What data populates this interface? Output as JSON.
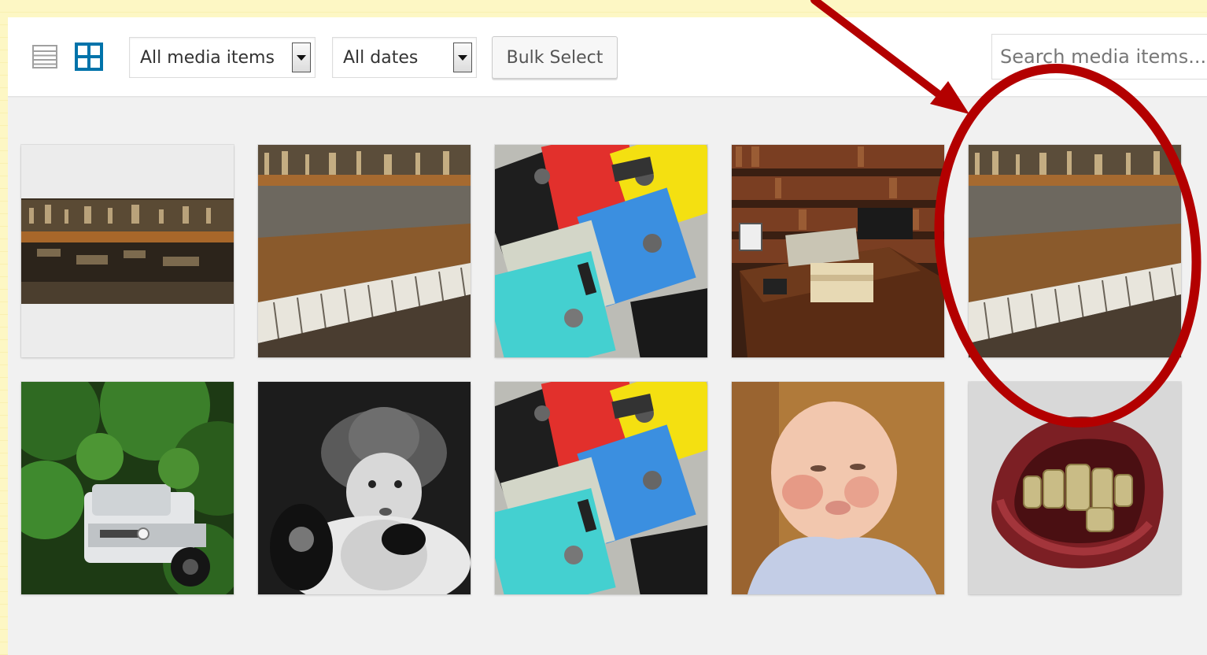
{
  "toolbar": {
    "view_list_icon": "list-view-icon",
    "view_grid_icon": "grid-view-icon",
    "filter_type": "All media items",
    "filter_date": "All dates",
    "bulk_select_label": "Bulk Select",
    "search_placeholder": "Search media items..."
  },
  "colors": {
    "accent": "#0073aa",
    "annotation_red": "#b30000",
    "background_border": "#fdf7c4"
  },
  "media_items": [
    {
      "thumbnail": "piano-keys-wide"
    },
    {
      "thumbnail": "old-piano"
    },
    {
      "thumbnail": "floppy-disks"
    },
    {
      "thumbnail": "desk-library"
    },
    {
      "thumbnail": "old-piano"
    },
    {
      "thumbnail": "car-under-tree"
    },
    {
      "thumbnail": "baby-with-phone-bw"
    },
    {
      "thumbnail": "floppy-disks"
    },
    {
      "thumbnail": "baby"
    },
    {
      "thumbnail": "teeth-toy"
    }
  ]
}
